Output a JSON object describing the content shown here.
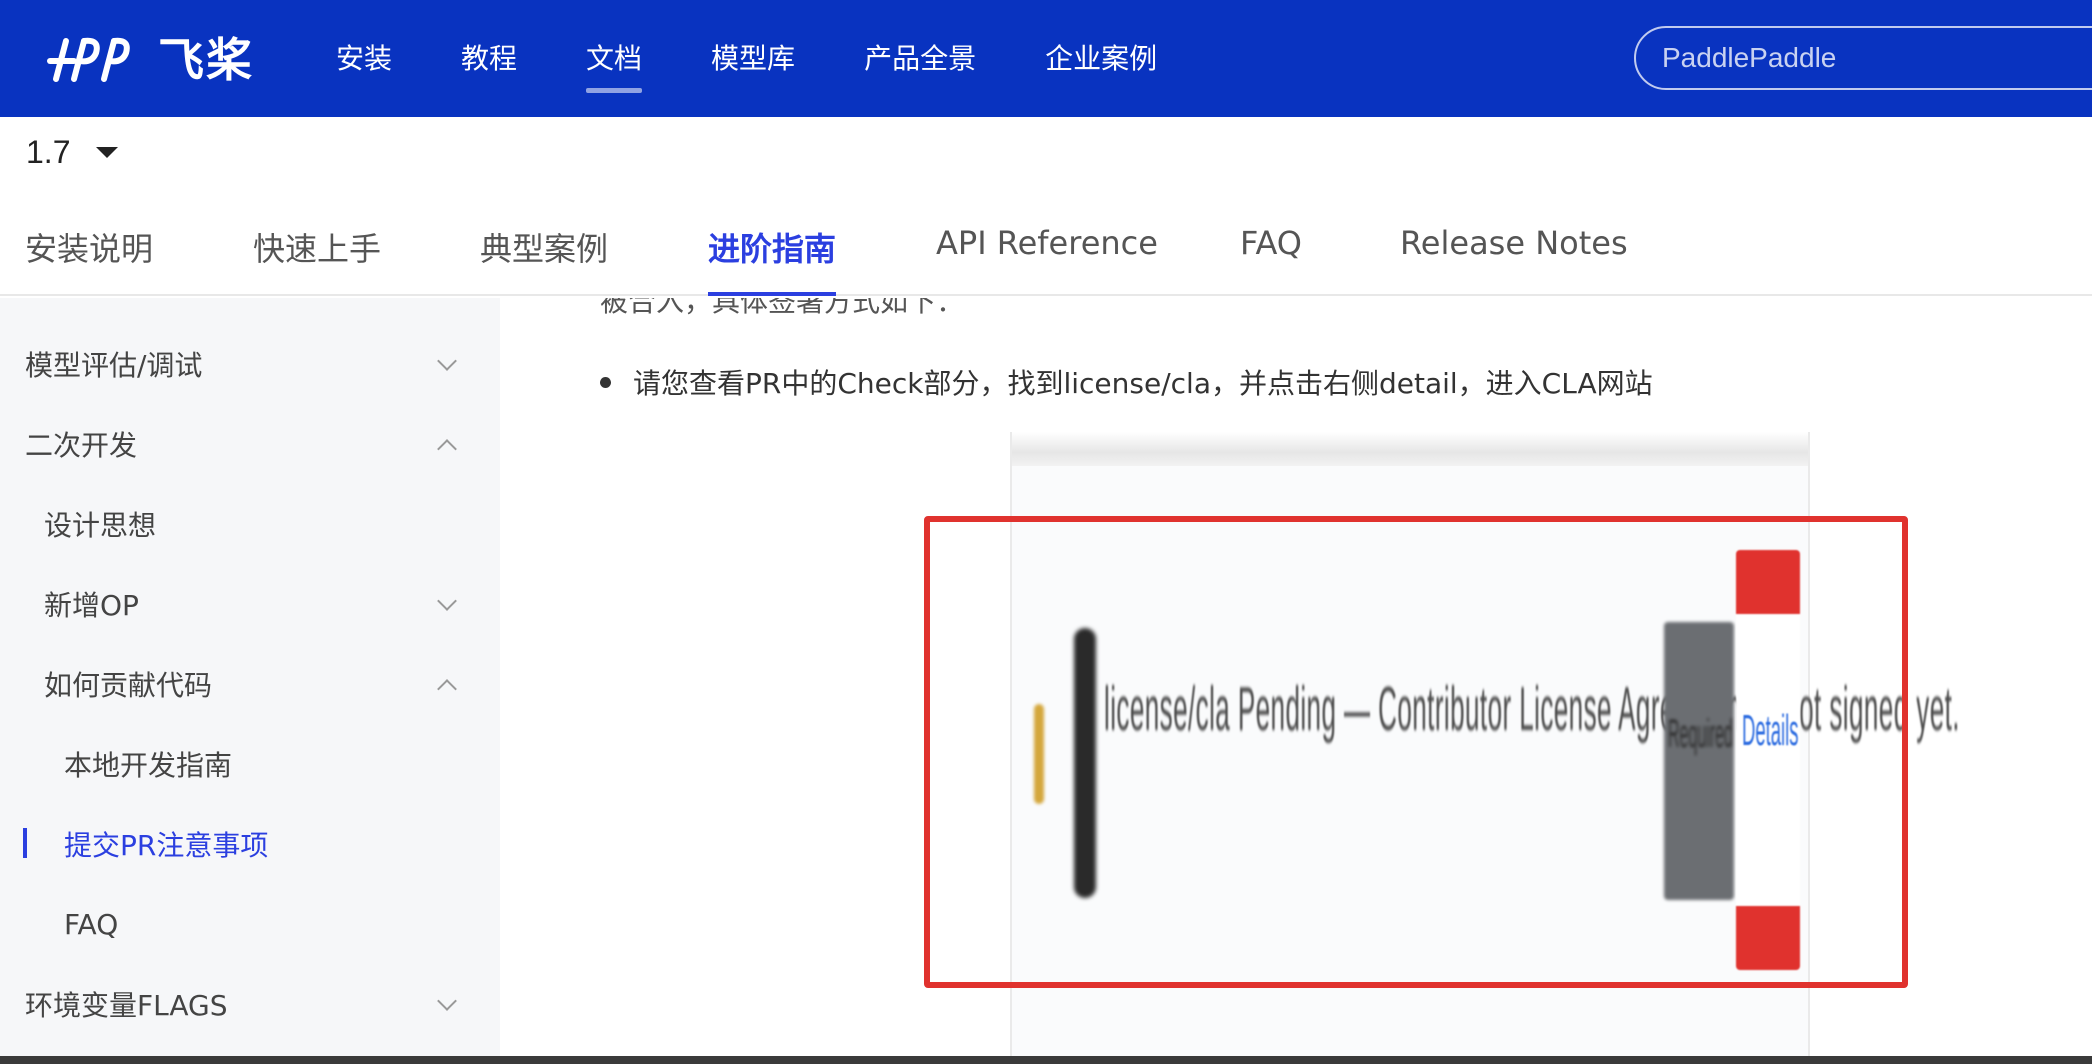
{
  "topbar": {
    "logo_text": "飞桨",
    "nav": [
      "安装",
      "教程",
      "文档",
      "模型库",
      "产品全景",
      "企业案例"
    ],
    "active_index": 2,
    "search_placeholder": "PaddlePaddle"
  },
  "version": "1.7",
  "tabs": [
    {
      "label": "安装说明",
      "active": false
    },
    {
      "label": "快速上手",
      "active": false
    },
    {
      "label": "典型案例",
      "active": false
    },
    {
      "label": "进阶指南",
      "active": true
    },
    {
      "label": "API Reference",
      "active": false
    },
    {
      "label": "FAQ",
      "active": false
    },
    {
      "label": "Release Notes",
      "active": false
    }
  ],
  "sidebar": {
    "items": [
      {
        "label": "模型评估/调试",
        "chevron": "down"
      },
      {
        "label": "二次开发",
        "chevron": "up"
      },
      {
        "label": "设计思想",
        "chevron": ""
      },
      {
        "label": "新增OP",
        "chevron": "down"
      },
      {
        "label": "如何贡献代码",
        "chevron": "up"
      },
      {
        "label": "本地开发指南",
        "chevron": ""
      },
      {
        "label": "提交PR注意事项",
        "chevron": "",
        "active": true
      },
      {
        "label": "FAQ",
        "chevron": ""
      },
      {
        "label": "环境变量FLAGS",
        "chevron": "down"
      }
    ]
  },
  "content": {
    "partial_line": "被合入，具体签署方式如下：",
    "bullet": "请您查看PR中的Check部分，找到license/cla，并点击右侧detail，进入CLA网站",
    "screenshot": {
      "check_text": "license/cla  Pending — Contributor License Agreement is not signed yet.",
      "required_label": "Required",
      "details_label": "Details"
    }
  },
  "colors": {
    "brand_blue": "#0933c0",
    "accent_blue": "#2b3fe0",
    "highlight_red": "#e0322e"
  }
}
